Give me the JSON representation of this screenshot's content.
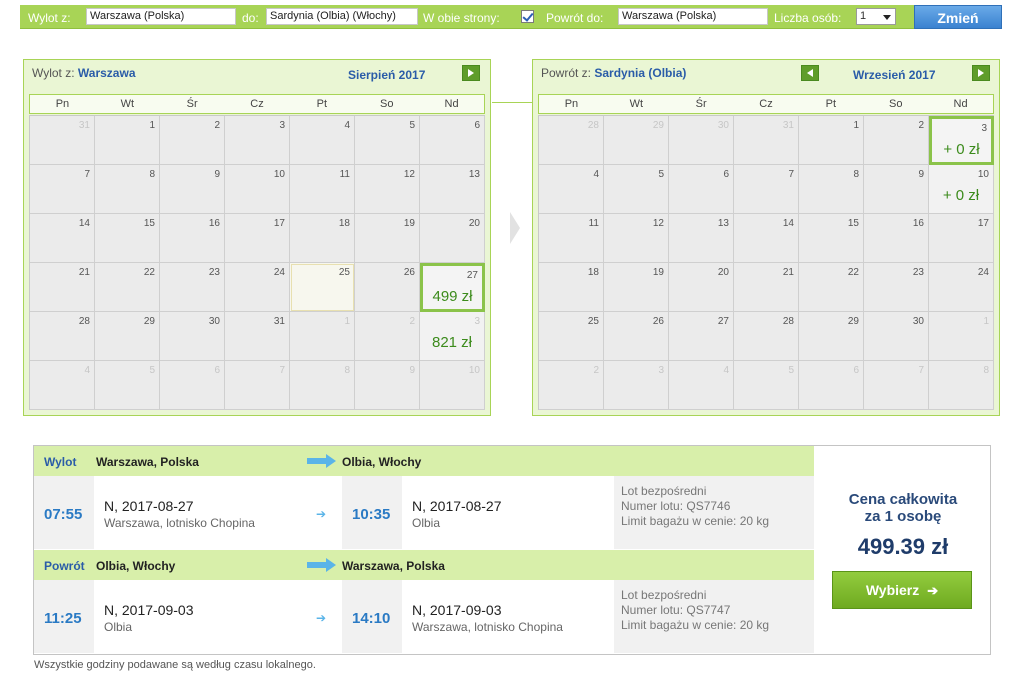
{
  "search_bar": {
    "from_label": "Wylot z:",
    "from_value": "Warszawa (Polska)",
    "to_label": "do:",
    "to_value": "Sardynia (Olbia) (Włochy)",
    "roundtrip_label": "W obie strony:",
    "return_label": "Powrót do:",
    "return_value": "Warszawa (Polska)",
    "passengers_label": "Liczba osób:",
    "passengers_value": "1",
    "submit_label": "Zmień"
  },
  "outbound_calendar": {
    "origin_prefix": "Wylot z:",
    "origin_city": "Warszawa",
    "month": "Sierpień 2017",
    "weekdays": [
      "Pn",
      "Wt",
      "Śr",
      "Cz",
      "Pt",
      "So",
      "Nd"
    ],
    "days": [
      {
        "n": "31",
        "dim": true
      },
      {
        "n": "1"
      },
      {
        "n": "2"
      },
      {
        "n": "3"
      },
      {
        "n": "4"
      },
      {
        "n": "5"
      },
      {
        "n": "6"
      },
      {
        "n": "7"
      },
      {
        "n": "8"
      },
      {
        "n": "9"
      },
      {
        "n": "10"
      },
      {
        "n": "11"
      },
      {
        "n": "12"
      },
      {
        "n": "13"
      },
      {
        "n": "14"
      },
      {
        "n": "15"
      },
      {
        "n": "16"
      },
      {
        "n": "17"
      },
      {
        "n": "18"
      },
      {
        "n": "19"
      },
      {
        "n": "20"
      },
      {
        "n": "21"
      },
      {
        "n": "22"
      },
      {
        "n": "23"
      },
      {
        "n": "24"
      },
      {
        "n": "25",
        "today": true
      },
      {
        "n": "26"
      },
      {
        "n": "27",
        "price": "499 zł",
        "selected": true
      },
      {
        "n": "28"
      },
      {
        "n": "29"
      },
      {
        "n": "30"
      },
      {
        "n": "31"
      },
      {
        "n": "1",
        "dim": true
      },
      {
        "n": "2",
        "dim": true
      },
      {
        "n": "3",
        "dim": true,
        "price": "821 zł"
      },
      {
        "n": "4",
        "dim": true
      },
      {
        "n": "5",
        "dim": true
      },
      {
        "n": "6",
        "dim": true
      },
      {
        "n": "7",
        "dim": true
      },
      {
        "n": "8",
        "dim": true
      },
      {
        "n": "9",
        "dim": true
      },
      {
        "n": "10",
        "dim": true
      }
    ]
  },
  "return_calendar": {
    "origin_prefix": "Powrót z:",
    "origin_city": "Sardynia (Olbia)",
    "month": "Wrzesień 2017",
    "weekdays": [
      "Pn",
      "Wt",
      "Śr",
      "Cz",
      "Pt",
      "So",
      "Nd"
    ],
    "days": [
      {
        "n": "28",
        "dim": true
      },
      {
        "n": "29",
        "dim": true
      },
      {
        "n": "30",
        "dim": true
      },
      {
        "n": "31",
        "dim": true
      },
      {
        "n": "1"
      },
      {
        "n": "2"
      },
      {
        "n": "3",
        "price": "+ 0 zł",
        "selected": true
      },
      {
        "n": "4"
      },
      {
        "n": "5"
      },
      {
        "n": "6"
      },
      {
        "n": "7"
      },
      {
        "n": "8"
      },
      {
        "n": "9"
      },
      {
        "n": "10",
        "price": "+ 0 zł"
      },
      {
        "n": "11"
      },
      {
        "n": "12"
      },
      {
        "n": "13"
      },
      {
        "n": "14"
      },
      {
        "n": "15"
      },
      {
        "n": "16"
      },
      {
        "n": "17"
      },
      {
        "n": "18"
      },
      {
        "n": "19"
      },
      {
        "n": "20"
      },
      {
        "n": "21"
      },
      {
        "n": "22"
      },
      {
        "n": "23"
      },
      {
        "n": "24"
      },
      {
        "n": "25"
      },
      {
        "n": "26"
      },
      {
        "n": "27"
      },
      {
        "n": "28"
      },
      {
        "n": "29"
      },
      {
        "n": "30"
      },
      {
        "n": "1",
        "dim": true
      },
      {
        "n": "2",
        "dim": true
      },
      {
        "n": "3",
        "dim": true
      },
      {
        "n": "4",
        "dim": true
      },
      {
        "n": "5",
        "dim": true
      },
      {
        "n": "6",
        "dim": true
      },
      {
        "n": "7",
        "dim": true
      },
      {
        "n": "8",
        "dim": true
      }
    ]
  },
  "summary": {
    "outbound": {
      "label": "Wylot",
      "from": "Warszawa, Polska",
      "to": "Olbia, Włochy",
      "dep_time": "07:55",
      "dep_date": "N, 2017-08-27",
      "dep_airport": "Warszawa, lotnisko Chopina",
      "arr_time": "10:35",
      "arr_date": "N, 2017-08-27",
      "arr_airport": "Olbia",
      "direct": "Lot bezpośredni",
      "flight_no": "Numer lotu: QS7746",
      "baggage": "Limit bagażu w cenie: 20 kg"
    },
    "return": {
      "label": "Powrót",
      "from": "Olbia, Włochy",
      "to": "Warszawa, Polska",
      "dep_time": "11:25",
      "dep_date": "N, 2017-09-03",
      "dep_airport": "Olbia",
      "arr_time": "14:10",
      "arr_date": "N, 2017-09-03",
      "arr_airport": "Warszawa, lotnisko Chopina",
      "direct": "Lot bezpośredni",
      "flight_no": "Numer lotu: QS7747",
      "baggage": "Limit bagażu w cenie: 20 kg"
    },
    "total_line1": "Cena całkowita",
    "total_line2": "za 1 osobę",
    "total_price": "499.39 zł",
    "select_label": "Wybierz",
    "select_arrow": "➔"
  },
  "footnote": "Wszystkie godziny podawane są według czasu lokalnego.",
  "colors": {
    "accent_green": "#a8d456",
    "price_green": "#3c8b1c",
    "link_blue": "#2a5ca8",
    "button_blue": "#3a82d0"
  }
}
